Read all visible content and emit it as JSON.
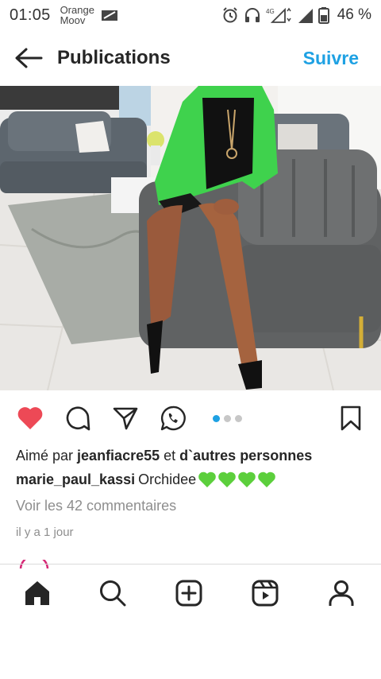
{
  "status_bar": {
    "time": "01:05",
    "carrier_line1": "Orange",
    "carrier_line2": "Moov",
    "network": "4G",
    "battery": "46 %"
  },
  "header": {
    "title": "Publications",
    "follow_label": "Suivre"
  },
  "post": {
    "carousel": {
      "count": 3,
      "active_index": 0
    },
    "likes": {
      "prefix": "Aimé par",
      "user": "jeanfiacre55",
      "middle": "et",
      "others": "d`autres personnes"
    },
    "caption": {
      "username": "marie_paul_kassi",
      "text": "Orchidee",
      "hearts": [
        "💚",
        "💚",
        "💚",
        "💚"
      ]
    },
    "view_comments": "Voir les 42 commentaires",
    "timestamp": "il y a 1 jour"
  },
  "icons": {
    "back": "arrow-left-icon",
    "like": "heart-icon",
    "comment": "comment-icon",
    "share": "send-icon",
    "whatsapp": "whatsapp-icon",
    "save": "bookmark-icon",
    "nav": [
      "home-icon",
      "search-icon",
      "add-post-icon",
      "reels-icon",
      "profile-icon"
    ]
  },
  "colors": {
    "accent": "#1ea1e3",
    "like": "#ed4956",
    "heart_green": "#5ccf3c"
  }
}
